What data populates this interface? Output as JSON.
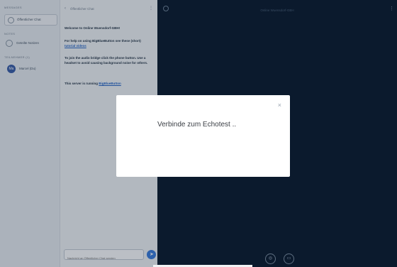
{
  "userlist": {
    "messages_label": "MESSAGES",
    "public_chat_label": "Öffentlicher Chat",
    "notes_label": "NOTES",
    "shared_notes_label": "Geteilte Notizen",
    "users_label": "TEILNEHMER (1)",
    "user_name": "Marcel (Du)",
    "user_initials": "Ma"
  },
  "chat": {
    "back_icon": "‹",
    "title": "Öffentlicher Chat",
    "more_icon": "⋮",
    "welcome": "Welcome to Online Wuensdorf-GBH!",
    "help_text": "For help on using BigBlueButton see these (short)",
    "help_link": "tutorial videos",
    "audio_text": "To join the audio bridge click the phone button. Use a headset to avoid causing background noise for others.",
    "server_text": "This server is running",
    "server_link": "BigBlueButton",
    "input_placeholder": "Nachricht an Öffentlicher Chat senden"
  },
  "presentation": {
    "meeting_title": "Online Wuensdorf-GBH",
    "options_icon": "⋮"
  },
  "modal": {
    "close_icon": "×",
    "message": "Verbinde zum Echotest .."
  },
  "actions": {
    "audio_icon": "◎",
    "video_icon": "▭"
  },
  "icons": {
    "chat": "chat-icon",
    "notes": "notes-icon",
    "send": "send-icon"
  },
  "colors": {
    "background": "#0b1a2d",
    "accent": "#3b7ddd",
    "panel": "#e9edf1"
  }
}
